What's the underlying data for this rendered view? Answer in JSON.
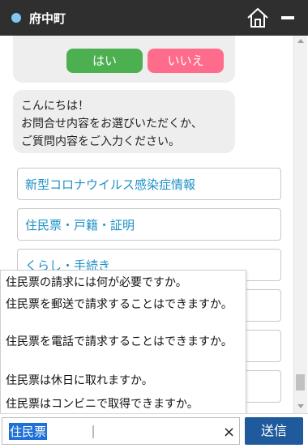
{
  "window": {
    "title": "府中町"
  },
  "quick_reply": {
    "yes": "はい",
    "no": "いいえ"
  },
  "greeting": {
    "lines": [
      "こんにちは！",
      "お問合せ内容をお選びいただくか、",
      "ご質問内容をご入力ください。"
    ]
  },
  "menu": [
    {
      "label": "新型コロナウイルス感染症情報"
    },
    {
      "label": "住民票・戸籍・証明"
    },
    {
      "label": "くらし・手続き"
    },
    {
      "label": ""
    },
    {
      "label": ""
    },
    {
      "label": ""
    }
  ],
  "suggestions": [
    "住民票の請求には何が必要ですか。",
    "住民票を郵送で請求することはできますか。",
    "住民票を電話で請求することはできますか。",
    "住民票は休日に取れますか。",
    "住民票はコンビニで取得できますか。"
  ],
  "input": {
    "value": "住民票",
    "clear": "×",
    "send_label": "送信"
  },
  "colors": {
    "titlebar": "#2f2f2f",
    "yes": "#4caf50",
    "no": "#ff6b8a",
    "link": "#1e90c8",
    "send": "#1f5a9c"
  },
  "icons": {
    "home": "home-icon",
    "minimize": "minimize-icon",
    "clear": "close-icon"
  }
}
